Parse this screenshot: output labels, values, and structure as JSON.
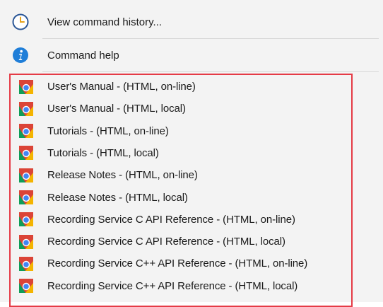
{
  "menu": {
    "history": {
      "label": "View command history...",
      "icon": "clock-icon"
    },
    "help": {
      "label": "Command help",
      "icon": "info-icon"
    },
    "docs": [
      {
        "label": "User's Manual - (HTML, on-line)"
      },
      {
        "label": "User's Manual - (HTML, local)"
      },
      {
        "label": "Tutorials - (HTML, on-line)"
      },
      {
        "label": "Tutorials - (HTML, local)"
      },
      {
        "label": "Release Notes - (HTML, on-line)"
      },
      {
        "label": "Release Notes - (HTML, local)"
      },
      {
        "label": "Recording Service C API Reference - (HTML, on-line)"
      },
      {
        "label": "Recording Service C API Reference - (HTML, local)"
      },
      {
        "label": "Recording Service C++ API Reference - (HTML, on-line)"
      },
      {
        "label": "Recording Service C++ API Reference - (HTML, local)"
      }
    ],
    "doc_icon": "chrome-browser-icon",
    "highlight_color": "#e53b46"
  }
}
